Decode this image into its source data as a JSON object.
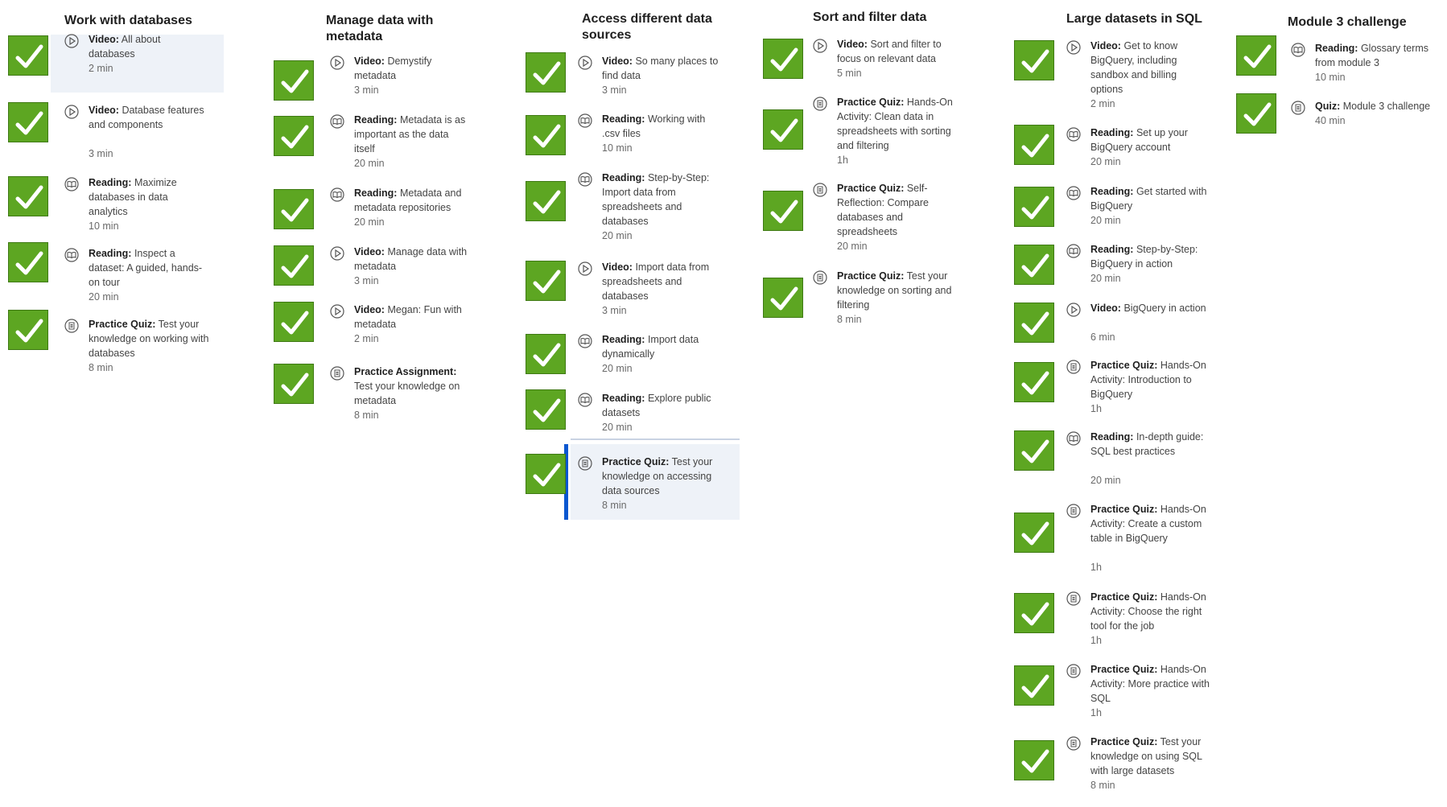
{
  "columns": [
    {
      "title": "Work with databases",
      "items": [
        {
          "type": "Video:",
          "title": "All about databases",
          "duration": "2 min",
          "icon": "play-icon"
        },
        {
          "type": "Video:",
          "title": "Database features and components",
          "duration": "3 min",
          "icon": "play-icon"
        },
        {
          "type": "Reading:",
          "title": "Maximize databases in data analytics",
          "duration": "10 min",
          "icon": "book-icon"
        },
        {
          "type": "Reading:",
          "title": "Inspect a dataset: A guided, hands-on tour",
          "duration": "20 min",
          "icon": "book-icon"
        },
        {
          "type": "Practice Quiz:",
          "title": "Test your knowledge on working with databases",
          "duration": "8 min",
          "icon": "quiz-icon"
        }
      ]
    },
    {
      "title": "Manage data with metadata",
      "items": [
        {
          "type": "Video:",
          "title": "Demystify metadata",
          "duration": "3 min",
          "icon": "play-icon"
        },
        {
          "type": "Reading:",
          "title": "Metadata is as important as the data itself",
          "duration": "20 min",
          "icon": "book-icon"
        },
        {
          "type": "Reading:",
          "title": "Metadata and metadata repositories",
          "duration": "20 min",
          "icon": "book-icon"
        },
        {
          "type": "Video:",
          "title": "Manage data with metadata",
          "duration": "3 min",
          "icon": "play-icon"
        },
        {
          "type": "Video:",
          "title": "Megan: Fun with metadata",
          "duration": "2 min",
          "icon": "play-icon"
        },
        {
          "type": "Practice Assignment:",
          "title": "Test your knowledge on metadata",
          "duration": "8 min",
          "icon": "quiz-icon"
        }
      ]
    },
    {
      "title": "Access different data sources",
      "items": [
        {
          "type": "Video:",
          "title": "So many places to find data",
          "duration": "3 min",
          "icon": "play-icon"
        },
        {
          "type": "Reading:",
          "title": "Working with .csv files",
          "duration": "10 min",
          "icon": "book-icon"
        },
        {
          "type": "Reading:",
          "title": "Step-by-Step: Import data from spreadsheets and databases",
          "duration": "20 min",
          "icon": "book-icon"
        },
        {
          "type": "Video:",
          "title": "Import data from spreadsheets and databases",
          "duration": "3 min",
          "icon": "play-icon"
        },
        {
          "type": "Reading:",
          "title": "Import data dynamically",
          "duration": "20 min",
          "icon": "book-icon"
        },
        {
          "type": "Reading:",
          "title": "Explore public datasets",
          "duration": "20 min",
          "icon": "book-icon"
        },
        {
          "type": "Practice Quiz:",
          "title": "Test your knowledge on accessing data sources",
          "duration": "8 min",
          "icon": "quiz-icon"
        }
      ]
    },
    {
      "title": "Sort and filter data",
      "items": [
        {
          "type": "Video:",
          "title": "Sort and filter to focus on relevant data",
          "duration": "5 min",
          "icon": "play-icon"
        },
        {
          "type": "Practice Quiz:",
          "title": "Hands-On Activity: Clean data in spreadsheets with sorting and filtering",
          "duration": "1h",
          "icon": "quiz-icon"
        },
        {
          "type": "Practice Quiz:",
          "title": "Self-Reflection: Compare databases and spreadsheets",
          "duration": "20 min",
          "icon": "quiz-icon"
        },
        {
          "type": "Practice Quiz:",
          "title": "Test your knowledge on sorting and filtering",
          "duration": "8 min",
          "icon": "quiz-icon"
        }
      ]
    },
    {
      "title": "Large datasets in SQL",
      "items": [
        {
          "type": "Video:",
          "title": "Get to know BigQuery, including sandbox and billing options",
          "duration": "2 min",
          "icon": "play-icon"
        },
        {
          "type": "Reading:",
          "title": "Set up your BigQuery account",
          "duration": "20 min",
          "icon": "book-icon"
        },
        {
          "type": "Reading:",
          "title": "Get started with BigQuery",
          "duration": "20 min",
          "icon": "book-icon"
        },
        {
          "type": "Reading:",
          "title": "Step-by-Step: BigQuery in action",
          "duration": "20 min",
          "icon": "book-icon"
        },
        {
          "type": "Video:",
          "title": "BigQuery in action",
          "duration": "6 min",
          "icon": "play-icon"
        },
        {
          "type": "Practice Quiz:",
          "title": "Hands-On Activity: Introduction to BigQuery",
          "duration": "1h",
          "icon": "quiz-icon"
        },
        {
          "type": "Reading:",
          "title": "In-depth guide: SQL best practices",
          "duration": "20 min",
          "icon": "book-icon"
        },
        {
          "type": "Practice Quiz:",
          "title": "Hands-On Activity: Create a custom table in BigQuery",
          "duration": "1h",
          "icon": "quiz-icon"
        },
        {
          "type": "Practice Quiz:",
          "title": "Hands-On Activity: Choose the right tool for the job",
          "duration": "1h",
          "icon": "quiz-icon"
        },
        {
          "type": "Practice Quiz:",
          "title": "Hands-On Activity: More practice with SQL",
          "duration": "1h",
          "icon": "quiz-icon"
        },
        {
          "type": "Practice Quiz:",
          "title": "Test your knowledge on using SQL with large datasets",
          "duration": "8 min",
          "icon": "quiz-icon"
        }
      ]
    },
    {
      "title": "Module 3 challenge",
      "items": [
        {
          "type": "Reading:",
          "title": "Glossary terms from module 3",
          "duration": "10 min",
          "icon": "book-icon"
        },
        {
          "type": "Quiz:",
          "title": "Module 3 challenge",
          "duration": "40 min",
          "icon": "quiz-icon"
        }
      ]
    }
  ],
  "colors": {
    "check": "#5da622",
    "highlight": "#eef2f8",
    "accent": "#0b57d0"
  }
}
